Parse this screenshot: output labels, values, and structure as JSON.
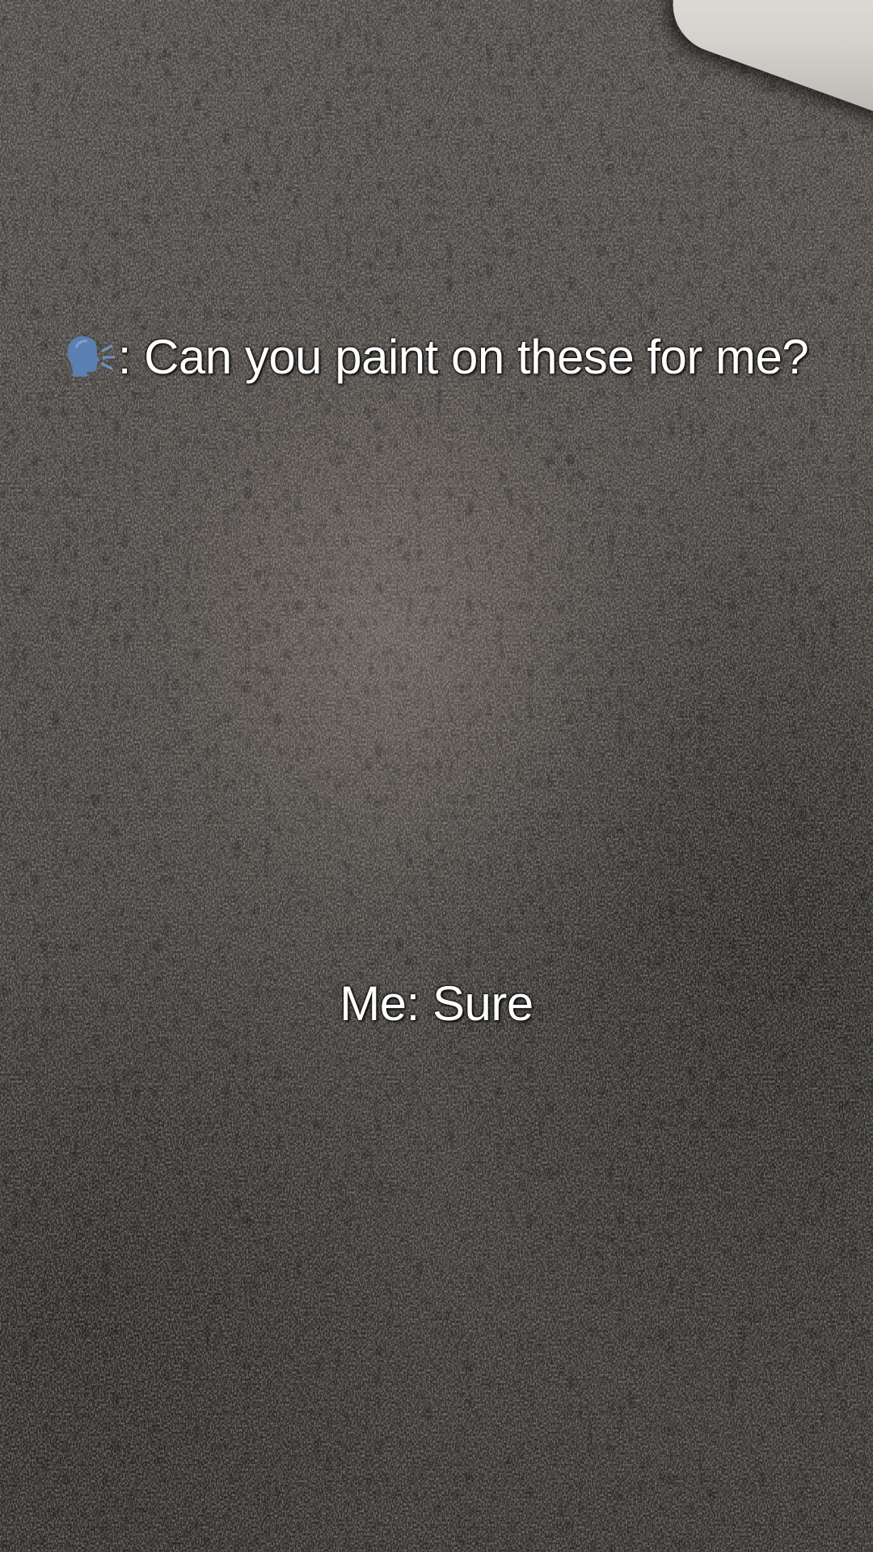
{
  "captions": {
    "top_icon": "speaking-head-icon",
    "top_text": ": Can you paint on these for me?",
    "bottom_text": "Me: Sure"
  },
  "colors": {
    "carpet": "#45413e",
    "pillow": "#e2dfdb",
    "caption_text": "#ffffff"
  }
}
